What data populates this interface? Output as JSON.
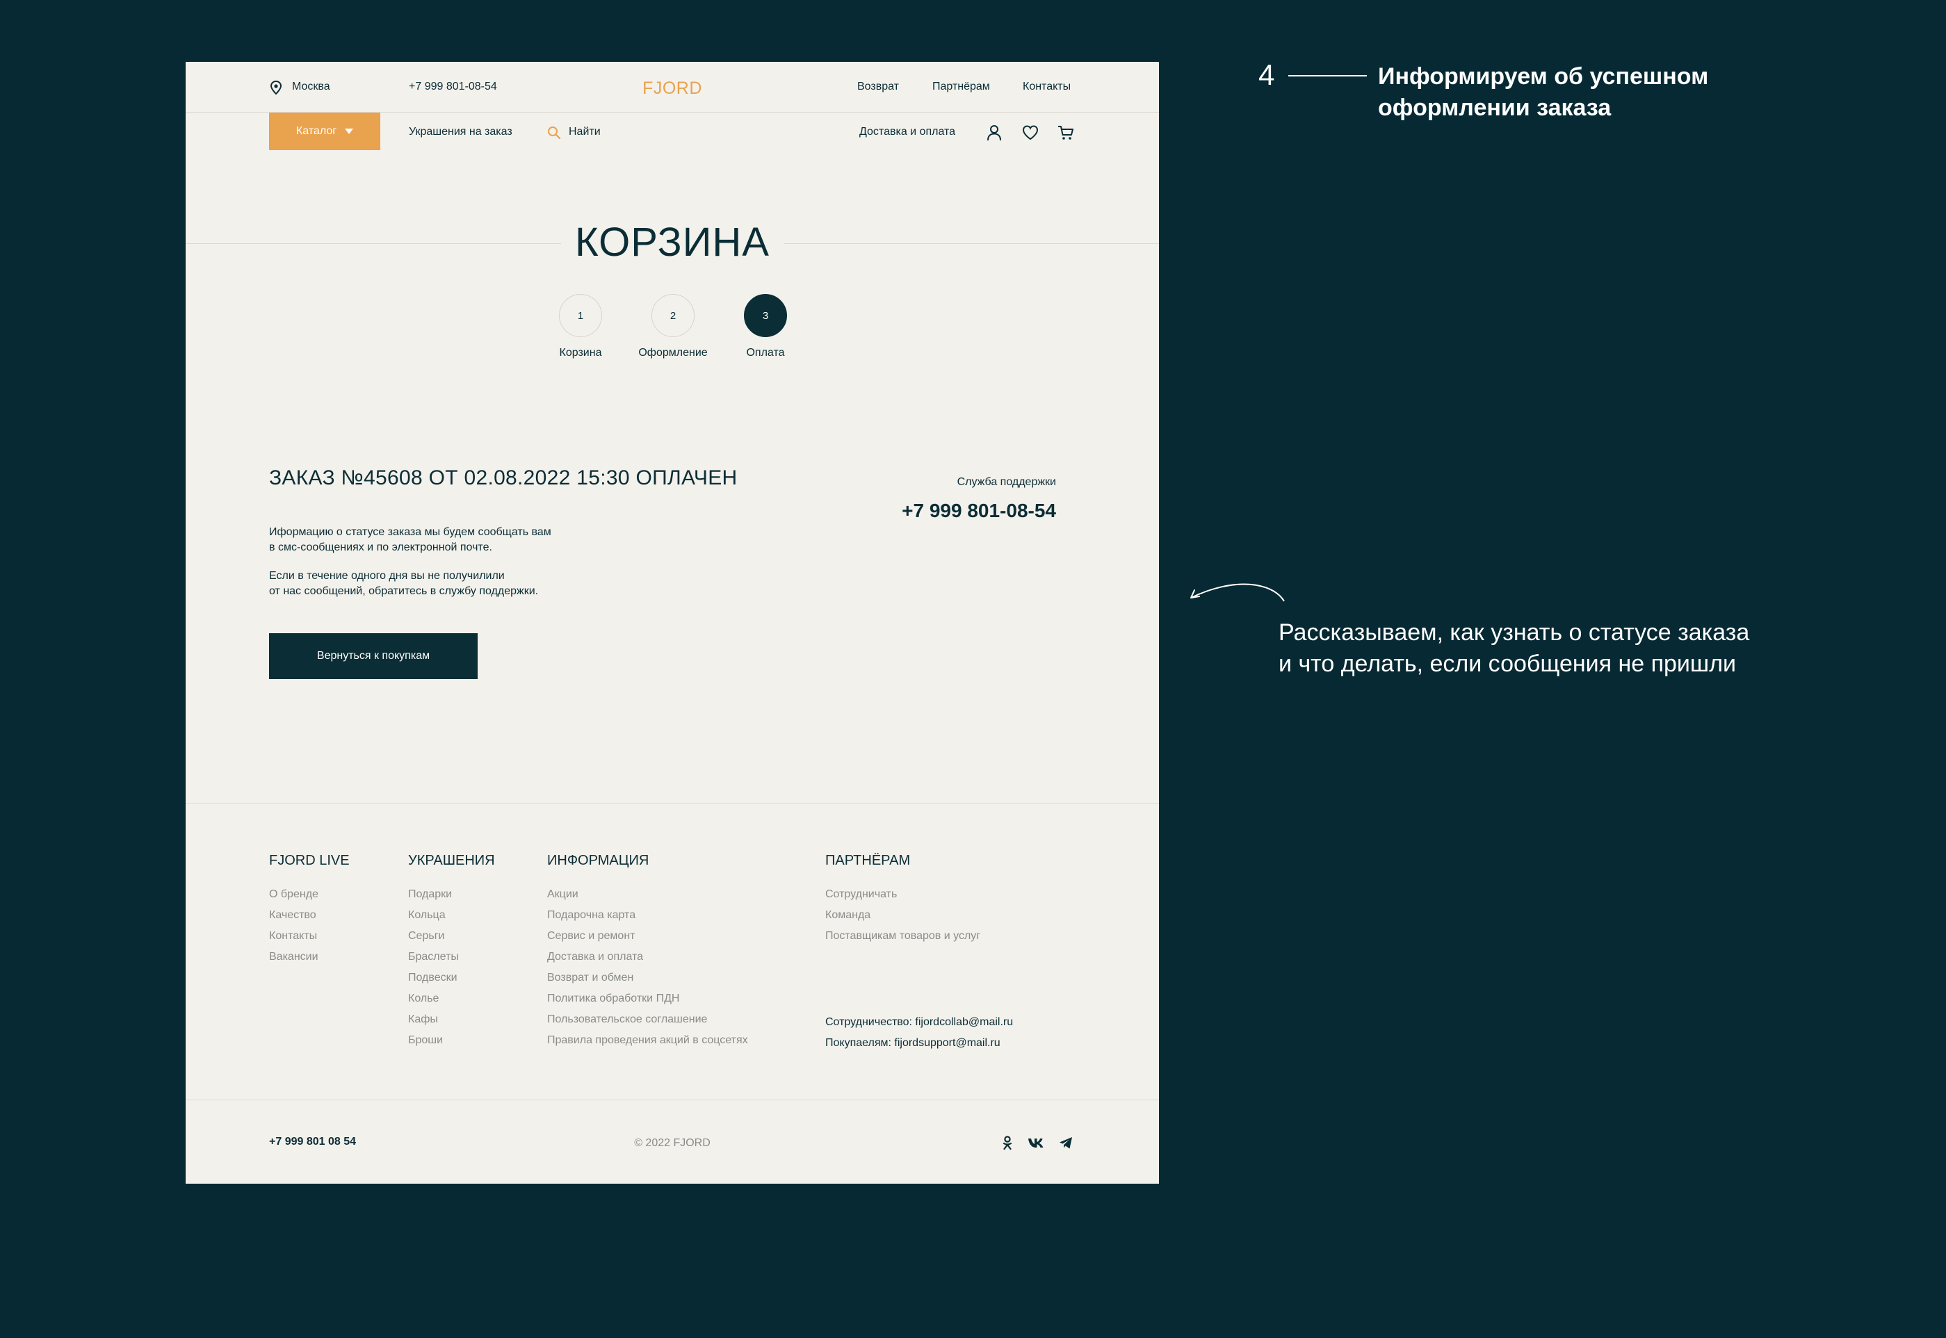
{
  "header": {
    "city": "Москва",
    "phone": "+7 999 801-08-54",
    "logo": "FJORD",
    "nav": [
      "Возврат",
      "Партнёрам",
      "Контакты"
    ]
  },
  "menubar": {
    "catalog_label": "Каталог",
    "custom_label": "Украшения на заказ",
    "search_placeholder": "Найти",
    "delivery_label": "Доставка и оплата"
  },
  "page_title": "КОРЗИНА",
  "steps": [
    {
      "num": "1",
      "label": "Корзина",
      "active": false
    },
    {
      "num": "2",
      "label": "Оформление",
      "active": false
    },
    {
      "num": "3",
      "label": "Оплата",
      "active": true
    }
  ],
  "order": {
    "title": "ЗАКАЗ №45608 ОТ 02.08.2022 15:30 ОПЛАЧЕН",
    "para1_line1": "Иформацию о статусе заказа мы будем сообщать вам",
    "para1_line2": "в смс-сообщениях и по электронной почте.",
    "para2_line1": "Если в течение одного дня вы не получилили",
    "para2_line2": "от нас сообщений, обратитесь в службу поддержки.",
    "button": "Вернуться к покупкам",
    "support_label": "Служба поддержки",
    "support_phone": "+7 999 801-08-54"
  },
  "footer": {
    "columns": [
      {
        "title": "FJORD LIVE",
        "links": [
          "О бренде",
          "Качество",
          "Контакты",
          "Вакансии"
        ]
      },
      {
        "title": "УКРАШЕНИЯ",
        "links": [
          "Подарки",
          "Кольца",
          "Серьги",
          "Браслеты",
          "Подвески",
          "Колье",
          "Кафы",
          "Броши"
        ]
      },
      {
        "title": "ИНФОРМАЦИЯ",
        "links": [
          "Акции",
          "Подарочна карта",
          "Сервис и ремонт",
          "Доставка и оплата",
          "Возврат и обмен",
          "Политика обработки ПДН",
          "Пользовательское соглашение",
          "Правила проведения акций в соцсетях"
        ]
      },
      {
        "title": "ПАРТНЁРАМ",
        "links": [
          "Сотрудничать",
          "Команда",
          "Поставщикам товаров и услуг"
        ]
      }
    ],
    "collab": "Сотрудничество: fijordcollab@mail.ru",
    "buyers": "Покупаелям: fijordsupport@mail.ru",
    "phone": "+7 999 801 08 54",
    "copyright": "© 2022 FJORD"
  },
  "annotations": {
    "number": "4",
    "title": "Информируем об успешном оформлении заказа",
    "body": "Рассказываем, как узнать о статусе заказа и что делать, если сообщения не пришли"
  },
  "colors": {
    "background": "#062933",
    "page": "#f3f1ec",
    "accent": "#e9a24e",
    "primary": "#0b2d35",
    "muted": "#8a8c88"
  },
  "icons": [
    "location-pin-icon",
    "search-icon",
    "user-icon",
    "heart-icon",
    "cart-icon",
    "odnoklassniki-icon",
    "vk-icon",
    "telegram-icon",
    "curved-arrow-icon"
  ]
}
